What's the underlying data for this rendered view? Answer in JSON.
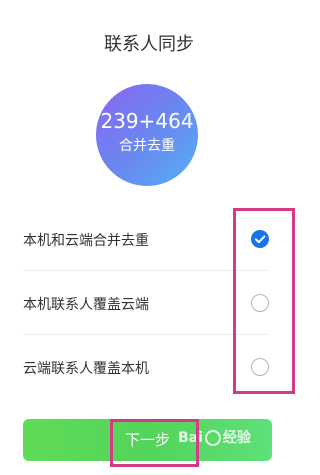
{
  "page": {
    "title": "联系人同步"
  },
  "summary": {
    "count": "239+464",
    "label": "合并去重"
  },
  "options": [
    {
      "label": "本机和云端合并去重",
      "selected": true
    },
    {
      "label": "本机联系人覆盖云端",
      "selected": false
    },
    {
      "label": "云端联系人覆盖本机",
      "selected": false
    }
  ],
  "next_button": {
    "label": "下一步"
  },
  "watermark": {
    "text_left": "Bai",
    "text_right": "经验"
  },
  "colors": {
    "checked_radio": "#1a73e8",
    "button_green": "#53d45a",
    "highlight": "#d63a86"
  }
}
